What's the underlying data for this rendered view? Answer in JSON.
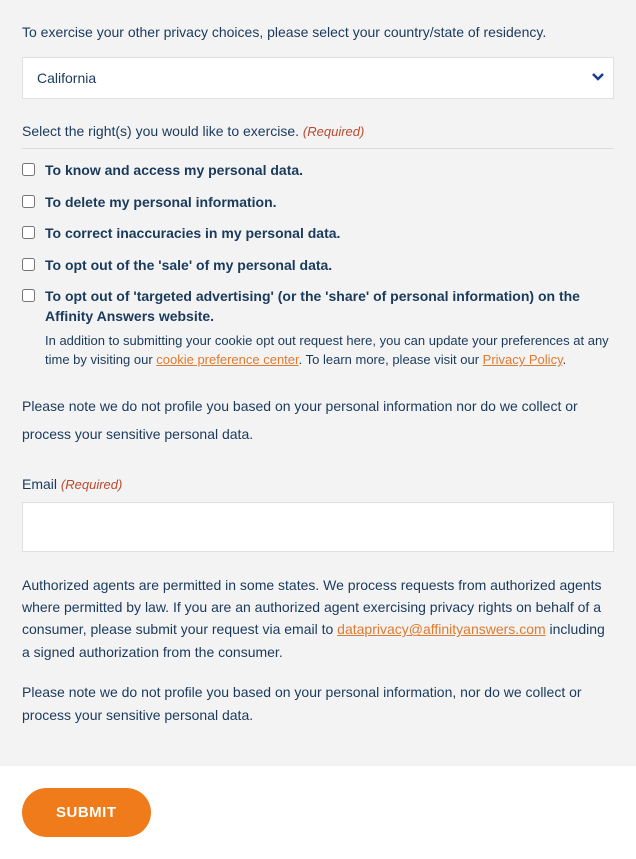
{
  "intro": "To exercise your other privacy choices, please select your country/state of residency.",
  "state_selected": "California",
  "rights_section": {
    "label": "Select the right(s) you would like to exercise.",
    "required": "(Required)"
  },
  "options": [
    {
      "label": "To know and access my personal data."
    },
    {
      "label": "To delete my personal information."
    },
    {
      "label": "To correct inaccuracies in my personal data."
    },
    {
      "label": "To opt out of the 'sale' of my personal data."
    },
    {
      "label": "To opt out of 'targeted advertising' (or the 'share' of personal information) on the Affinity Answers website."
    }
  ],
  "helper": {
    "pre": "In addition to submitting your cookie opt out request here, you can update your preferences at any time by visiting our ",
    "link1": "cookie preference center",
    "mid": ". To learn more, please visit our ",
    "link2": "Privacy Policy",
    "post": "."
  },
  "note1": "Please note we do not profile you based on your personal information nor do we collect or process your sensitive personal data.",
  "email": {
    "label": "Email",
    "required": "(Required)"
  },
  "agent": {
    "pre": "Authorized agents are permitted in some states. We process requests from authorized agents where permitted by law. If you are an authorized agent exercising privacy rights on behalf of a consumer, please submit your request via email to ",
    "link": "dataprivacy@affinityanswers.com",
    "post": " including a signed authorization from the consumer."
  },
  "note2": "Please note we do not profile you based on your personal information, nor do we collect or process your sensitive personal data.",
  "submit_label": "SUBMIT"
}
